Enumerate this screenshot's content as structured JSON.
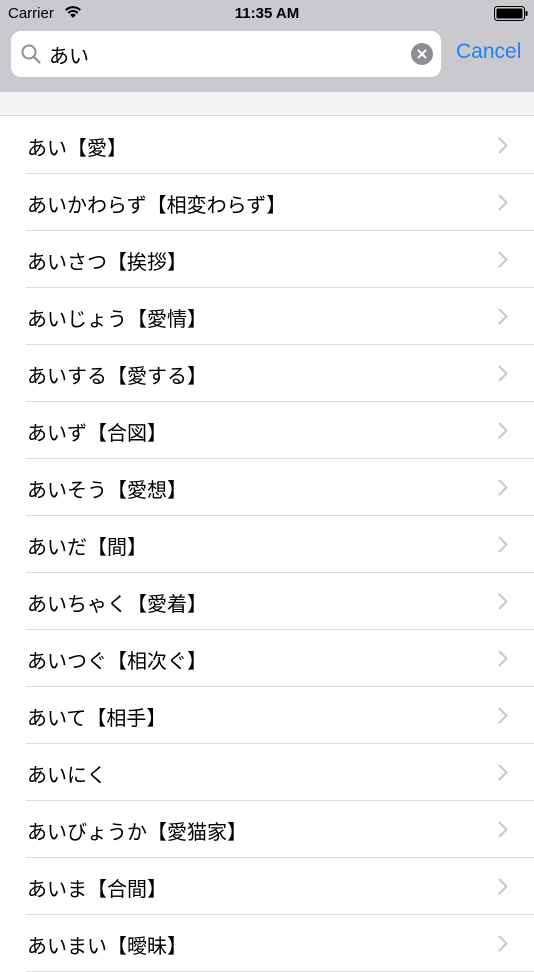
{
  "status_bar": {
    "carrier": "Carrier",
    "time": "11:35 AM"
  },
  "search": {
    "query": "あい",
    "cancel_label": "Cancel"
  },
  "results": [
    {
      "label": "あい【愛】"
    },
    {
      "label": "あいかわらず【相変わらず】"
    },
    {
      "label": "あいさつ【挨拶】"
    },
    {
      "label": "あいじょう【愛情】"
    },
    {
      "label": "あいする【愛する】"
    },
    {
      "label": "あいず【合図】"
    },
    {
      "label": "あいそう【愛想】"
    },
    {
      "label": "あいだ【間】"
    },
    {
      "label": "あいちゃく【愛着】"
    },
    {
      "label": "あいつぐ【相次ぐ】"
    },
    {
      "label": "あいて【相手】"
    },
    {
      "label": "あいにく"
    },
    {
      "label": "あいびょうか【愛猫家】"
    },
    {
      "label": "あいま【合間】"
    },
    {
      "label": "あいまい【曖昧】"
    }
  ],
  "colors": {
    "accent": "#1a82fb",
    "header_bg": "#c9c9ce",
    "chevron": "#c7c7cc"
  },
  "icons": {
    "search": "search-icon",
    "clear": "clear-icon",
    "chevron": "chevron-right-icon",
    "wifi": "wifi-icon",
    "battery": "battery-icon"
  }
}
